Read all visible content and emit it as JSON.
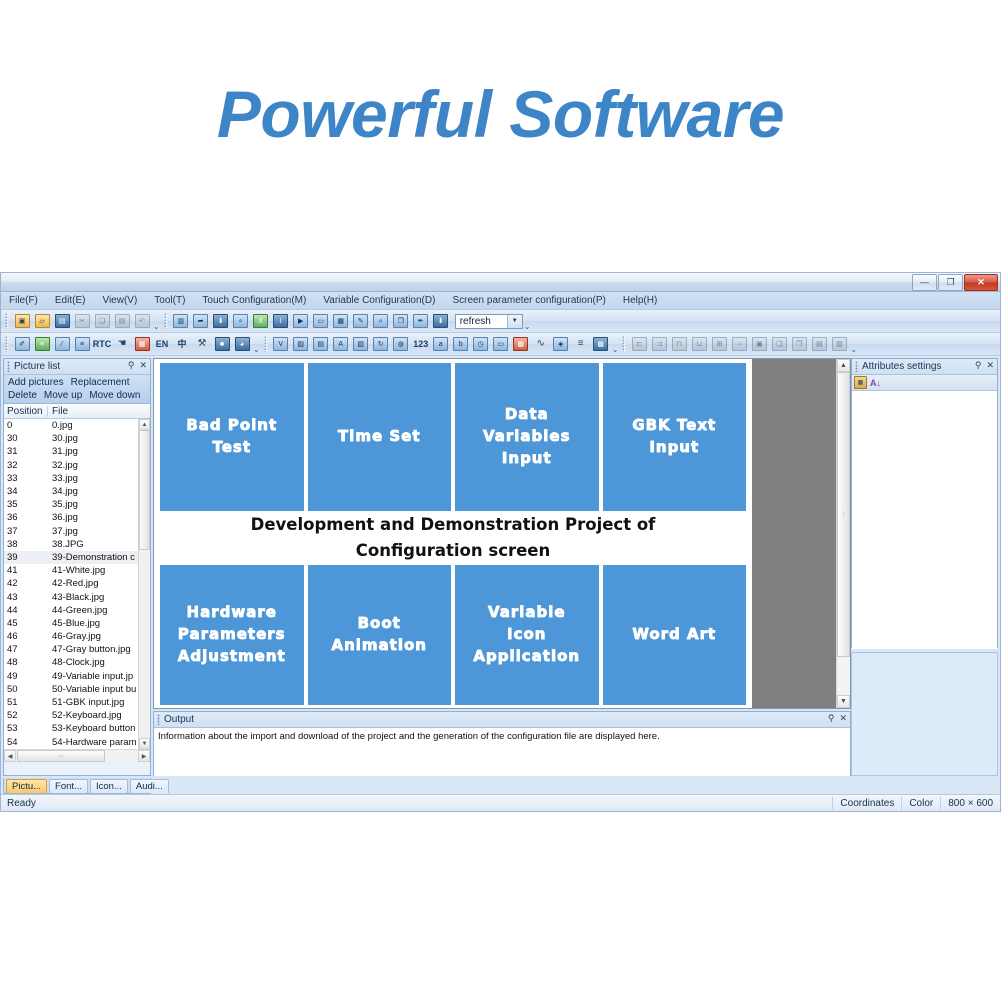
{
  "hero": {
    "title": "Powerful Software"
  },
  "window": {
    "buttons": {
      "minimize": "—",
      "maximize": "❐",
      "close": "✕"
    }
  },
  "menubar": {
    "items": [
      "File(F)",
      "Edit(E)",
      "View(V)",
      "Tool(T)",
      "Touch Configuration(M)",
      "Variable Configuration(D)",
      "Screen parameter configuration(P)",
      "Help(H)"
    ]
  },
  "toolbar_row1": {
    "icons": [
      "new-project-icon",
      "open-folder-icon",
      "save-icon",
      "cut-icon",
      "copy-icon",
      "paste-icon",
      "undo-icon",
      "new-screen-icon",
      "import-picture-icon",
      "download-icon",
      "preview-icon",
      "export-excel-icon",
      "text-tool-icon",
      "run-icon",
      "keyboard-icon",
      "table-icon",
      "edit-pen-icon",
      "zoom-icon",
      "copy-screen-icon",
      "eyedropper-icon",
      "download-config-icon"
    ],
    "combo_value": "refresh"
  },
  "toolbar_row2": {
    "icons": [
      "touch-edit-icon",
      "list-config-icon",
      "slider-icon",
      "level-icon",
      "rtc-icon",
      "hand-touch-icon",
      "grid-alarm-icon",
      "en-lang-icon",
      "cn-lang-icon",
      "tools-icon",
      "fill-icon",
      "clock-dial-icon",
      "variable-icon",
      "image-variable-icon",
      "data-icon",
      "font-icon",
      "picture-variable-icon",
      "rotate-icon",
      "gauge-icon",
      "number-123-icon",
      "abc-icon",
      "abc-alt-icon",
      "clock-icon",
      "bit-icon",
      "icon-lib-icon",
      "curve-icon",
      "shield-icon",
      "list-icon",
      "qr-code-icon"
    ],
    "labels": {
      "rtc": "RTC",
      "en": "EN",
      "cn": "中",
      "num": "123",
      "abc": "abc",
      "abc2": "abc"
    },
    "align_icons": [
      "align-left-icon",
      "align-right-icon",
      "align-top-icon",
      "align-bottom-icon",
      "align-center-icon",
      "distribute-icon",
      "same-size-icon",
      "bring-front-icon",
      "send-back-icon",
      "group-icon",
      "ungroup-icon"
    ]
  },
  "picture_list": {
    "title": "Picture list",
    "pin_icon": "pin-icon",
    "close_icon": "close-icon",
    "actions_row1": [
      "Add pictures",
      "Replacement"
    ],
    "actions_row2": [
      "Delete",
      "Move up",
      "Move down"
    ],
    "columns": [
      "Position",
      "File"
    ],
    "rows": [
      {
        "position": "0",
        "file": "0.jpg"
      },
      {
        "position": "30",
        "file": "30.jpg"
      },
      {
        "position": "31",
        "file": "31.jpg"
      },
      {
        "position": "32",
        "file": "32.jpg"
      },
      {
        "position": "33",
        "file": "33.jpg"
      },
      {
        "position": "34",
        "file": "34.jpg"
      },
      {
        "position": "35",
        "file": "35.jpg"
      },
      {
        "position": "36",
        "file": "36.jpg"
      },
      {
        "position": "37",
        "file": "37.jpg"
      },
      {
        "position": "38",
        "file": "38.JPG"
      },
      {
        "position": "39",
        "file": "39-Demonstration c",
        "selected": true
      },
      {
        "position": "41",
        "file": "41-White.jpg"
      },
      {
        "position": "42",
        "file": "42-Red.jpg"
      },
      {
        "position": "43",
        "file": "43-Black.jpg"
      },
      {
        "position": "44",
        "file": "44-Green.jpg"
      },
      {
        "position": "45",
        "file": "45-Blue.jpg"
      },
      {
        "position": "46",
        "file": "46-Gray.jpg"
      },
      {
        "position": "47",
        "file": "47-Gray button.jpg"
      },
      {
        "position": "48",
        "file": "48-Clock.jpg"
      },
      {
        "position": "49",
        "file": "49-Variable input.jp"
      },
      {
        "position": "50",
        "file": "50-Variable input bu"
      },
      {
        "position": "51",
        "file": "51-GBK input.jpg"
      },
      {
        "position": "52",
        "file": "52-Keyboard.jpg"
      },
      {
        "position": "53",
        "file": "53-Keyboard button"
      },
      {
        "position": "54",
        "file": "54-Hardware param"
      }
    ],
    "tabs": [
      {
        "label": "Pictu...",
        "active": true
      },
      {
        "label": "Font...",
        "active": false
      },
      {
        "label": "Icon...",
        "active": false
      },
      {
        "label": "Audi...",
        "active": false
      }
    ]
  },
  "canvas": {
    "tiles": [
      {
        "lines": [
          "Bad Point",
          "Test"
        ]
      },
      {
        "lines": [
          "Time Set"
        ]
      },
      {
        "lines": [
          "Data",
          "Variables",
          "Input"
        ]
      },
      {
        "lines": [
          "GBK Text",
          "Input"
        ]
      },
      {
        "lines": [
          "Hardware",
          "Parameters",
          "Adjustment"
        ]
      },
      {
        "lines": [
          "Boot",
          "Animation"
        ]
      },
      {
        "lines": [
          "Variable",
          "Icon",
          "Application"
        ]
      },
      {
        "lines": [
          "Word Art"
        ]
      }
    ],
    "banner": [
      "Development and Demonstration Project of",
      "Configuration screen"
    ],
    "tile_color": "#4d97d9",
    "workspace_color": "#808080"
  },
  "output": {
    "title": "Output",
    "pin_icon": "pin-icon",
    "close_icon": "close-icon",
    "message": "Information about the import and download of the project and the generation of the configuration file are displayed here."
  },
  "attributes": {
    "title": "Attributes settings",
    "pin_icon": "pin-icon",
    "close_icon": "close-icon",
    "toolbar_icons": [
      "categorized-icon",
      "sort-alphabetical-icon"
    ]
  },
  "statusbar": {
    "ready": "Ready",
    "coordinates": "Coordinates",
    "color": "Color",
    "resolution": "800 × 600"
  }
}
